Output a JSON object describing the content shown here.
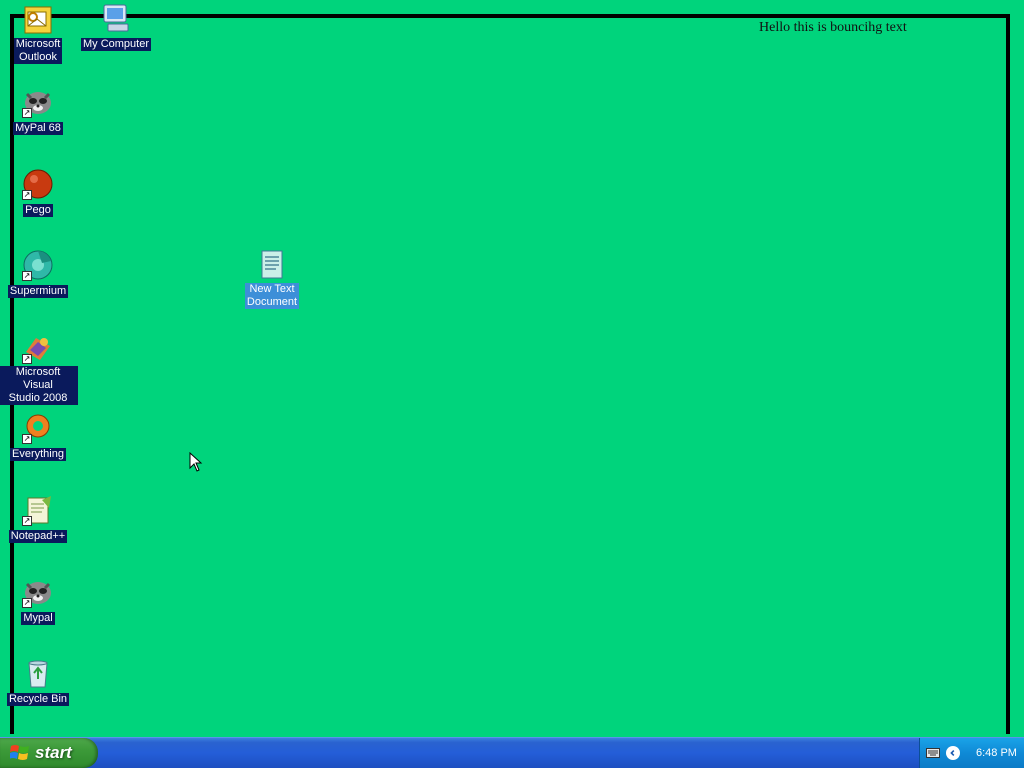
{
  "screensaver": {
    "text": "Hello this is bouncihg text"
  },
  "desktop": {
    "icons": [
      {
        "label": "Microsoft\nOutlook",
        "icon": "outlook-icon",
        "shortcut": false
      },
      {
        "label": "My Computer",
        "icon": "my-computer-icon",
        "shortcut": false
      },
      {
        "label": "MyPal 68",
        "icon": "mypal-icon",
        "shortcut": true
      },
      {
        "label": "Pego",
        "icon": "pego-icon",
        "shortcut": true
      },
      {
        "label": "Supermium",
        "icon": "supermium-icon",
        "shortcut": true
      },
      {
        "label": "New Text\nDocument",
        "icon": "text-document-icon",
        "shortcut": false,
        "selected": true
      },
      {
        "label": "Microsoft Visual\nStudio 2008",
        "icon": "visual-studio-icon",
        "shortcut": true
      },
      {
        "label": "Everything",
        "icon": "everything-icon",
        "shortcut": true
      },
      {
        "label": "Notepad++",
        "icon": "notepadpp-icon",
        "shortcut": true
      },
      {
        "label": "Mypal",
        "icon": "mypal-icon",
        "shortcut": true
      },
      {
        "label": "Recycle Bin",
        "icon": "recycle-bin-icon",
        "shortcut": false
      }
    ]
  },
  "taskbar": {
    "start_label": "start",
    "clock": "6:48 PM"
  },
  "colors": {
    "desktop_background": "#00d47c",
    "taskbar": "#245ed8",
    "start_button": "#3c9a39"
  }
}
